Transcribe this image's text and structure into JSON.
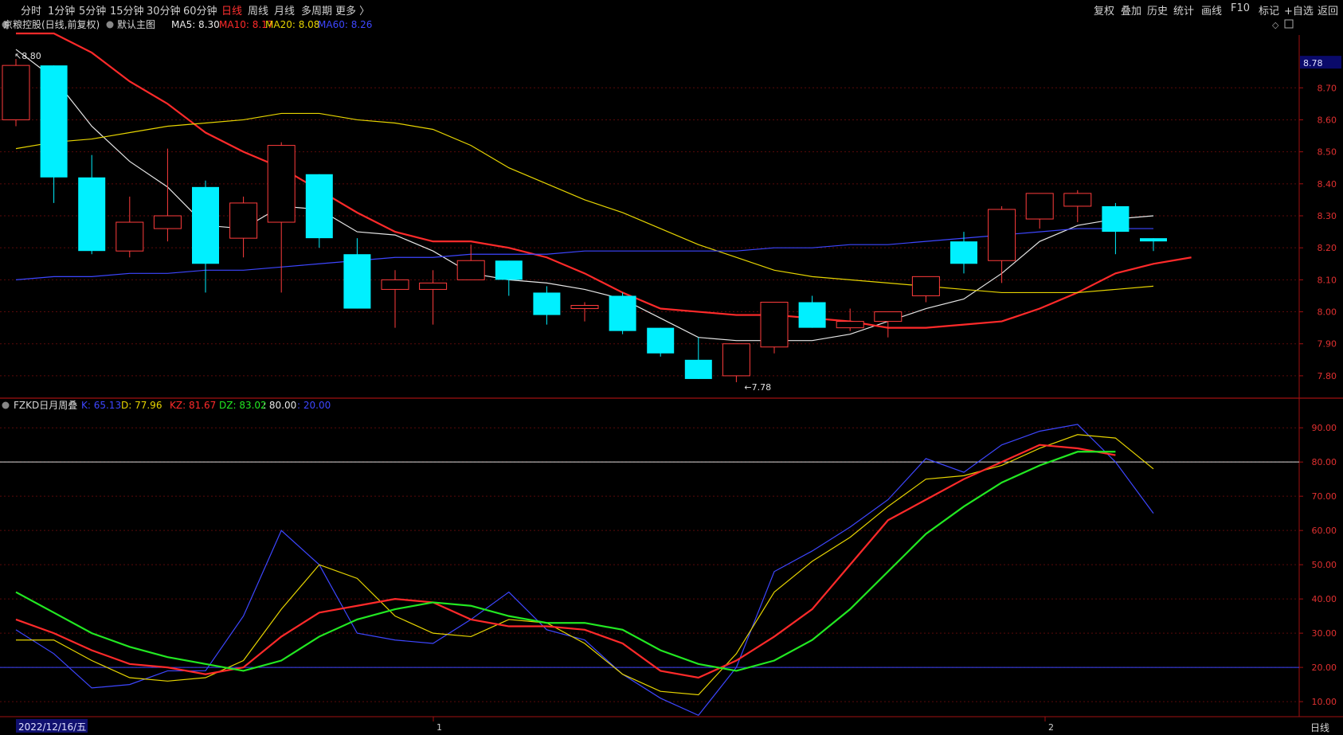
{
  "toolbar": {
    "left": [
      {
        "label": "分时",
        "active": false
      },
      {
        "label": "1分钟",
        "active": false
      },
      {
        "label": "5分钟",
        "active": false
      },
      {
        "label": "15分钟",
        "active": false
      },
      {
        "label": "30分钟",
        "active": false
      },
      {
        "label": "60分钟",
        "active": false
      },
      {
        "label": "日线",
        "active": true
      },
      {
        "label": "周线",
        "active": false
      },
      {
        "label": "月线",
        "active": false
      },
      {
        "label": "多周期",
        "active": false
      },
      {
        "label": "更多 〉",
        "active": false
      }
    ],
    "right": [
      "复权",
      "叠加",
      "历史",
      "统计",
      "画线",
      "F10",
      "标记",
      "+自选",
      "返回"
    ]
  },
  "main_header": {
    "stock": "京粮控股(日线,前复权)",
    "template": "默认主图",
    "ma": [
      {
        "label": "MA5: 8.30",
        "color": "#e6e6e6"
      },
      {
        "label": "MA10: 8.17",
        "color": "#ff2a2a"
      },
      {
        "label": "MA20: 8.08",
        "color": "#e6d400"
      },
      {
        "label": "MA60: 8.26",
        "color": "#3d46ff"
      }
    ]
  },
  "sub_header": {
    "name": "FZKD日月周叠",
    "items": [
      {
        "label": "K: 65.13",
        "color": "#3d46ff"
      },
      {
        "label": "D: 77.96",
        "color": "#e6d400"
      },
      {
        "label": "KZ: 81.67",
        "color": "#ff2a2a"
      },
      {
        "label": "DZ: 83.02",
        "color": "#22e822"
      },
      {
        "label": ": 80.00",
        "color": "#e6e6e6"
      },
      {
        "label": ": 20.00",
        "color": "#3d46ff"
      }
    ]
  },
  "bottom_axis": {
    "date_label": "2022/12/16/五",
    "month_labels": [
      "1",
      "2"
    ],
    "period_label": "日线"
  },
  "colors": {
    "up": "#ff3c3c",
    "down": "#00f0ff",
    "ma5": "#e6e6e6",
    "ma10": "#ff2a2a",
    "ma20": "#e6d400",
    "ma60": "#3d46ff",
    "dz": "#22e822",
    "grid": "#5a0a0a",
    "border": "#a01010"
  },
  "chart_data": [
    {
      "type": "candlestick",
      "title": "京粮控股(日线,前复权)",
      "ylim": [
        7.75,
        8.85
      ],
      "y_ticks": [
        7.8,
        7.9,
        8.0,
        8.1,
        8.2,
        8.3,
        8.4,
        8.5,
        8.6,
        8.7
      ],
      "current_price": "8.78",
      "high_label": "8.80",
      "low_label": "7.78",
      "candles": [
        {
          "o": 8.6,
          "h": 8.79,
          "l": 8.58,
          "c": 8.77
        },
        {
          "o": 8.77,
          "h": 8.77,
          "l": 8.34,
          "c": 8.42
        },
        {
          "o": 8.42,
          "h": 8.49,
          "l": 8.18,
          "c": 8.19
        },
        {
          "o": 8.19,
          "h": 8.36,
          "l": 8.17,
          "c": 8.28
        },
        {
          "o": 8.26,
          "h": 8.51,
          "l": 8.22,
          "c": 8.3
        },
        {
          "o": 8.39,
          "h": 8.41,
          "l": 8.06,
          "c": 8.15
        },
        {
          "o": 8.23,
          "h": 8.36,
          "l": 8.17,
          "c": 8.34
        },
        {
          "o": 8.28,
          "h": 8.53,
          "l": 8.06,
          "c": 8.52
        },
        {
          "o": 8.43,
          "h": 8.43,
          "l": 8.2,
          "c": 8.23
        },
        {
          "o": 8.18,
          "h": 8.23,
          "l": 8.01,
          "c": 8.01
        },
        {
          "o": 8.07,
          "h": 8.13,
          "l": 7.95,
          "c": 8.1
        },
        {
          "o": 8.07,
          "h": 8.13,
          "l": 7.96,
          "c": 8.09
        },
        {
          "o": 8.1,
          "h": 8.21,
          "l": 8.1,
          "c": 8.16
        },
        {
          "o": 8.16,
          "h": 8.16,
          "l": 8.05,
          "c": 8.1
        },
        {
          "o": 8.06,
          "h": 8.08,
          "l": 7.96,
          "c": 7.99
        },
        {
          "o": 8.01,
          "h": 8.03,
          "l": 7.97,
          "c": 8.02
        },
        {
          "o": 8.05,
          "h": 8.06,
          "l": 7.93,
          "c": 7.94
        },
        {
          "o": 7.95,
          "h": 7.95,
          "l": 7.86,
          "c": 7.87
        },
        {
          "o": 7.85,
          "h": 7.92,
          "l": 7.79,
          "c": 7.79
        },
        {
          "o": 7.8,
          "h": 7.9,
          "l": 7.78,
          "c": 7.9
        },
        {
          "o": 7.89,
          "h": 8.03,
          "l": 7.87,
          "c": 8.03
        },
        {
          "o": 8.03,
          "h": 8.05,
          "l": 7.95,
          "c": 7.95
        },
        {
          "o": 7.95,
          "h": 8.01,
          "l": 7.94,
          "c": 7.97
        },
        {
          "o": 7.97,
          "h": 8.0,
          "l": 7.92,
          "c": 8.0
        },
        {
          "o": 8.05,
          "h": 8.11,
          "l": 8.03,
          "c": 8.11
        },
        {
          "o": 8.22,
          "h": 8.25,
          "l": 8.12,
          "c": 8.15
        },
        {
          "o": 8.16,
          "h": 8.33,
          "l": 8.09,
          "c": 8.32
        },
        {
          "o": 8.29,
          "h": 8.37,
          "l": 8.26,
          "c": 8.37
        },
        {
          "o": 8.33,
          "h": 8.38,
          "l": 8.28,
          "c": 8.37
        },
        {
          "o": 8.33,
          "h": 8.34,
          "l": 8.18,
          "c": 8.25
        },
        {
          "o": 8.23,
          "h": 8.23,
          "l": 8.19,
          "c": 8.22
        }
      ],
      "series": [
        {
          "name": "MA5",
          "values": [
            8.82,
            8.73,
            8.58,
            8.47,
            8.39,
            8.27,
            8.26,
            8.33,
            8.32,
            8.25,
            8.24,
            8.19,
            8.12,
            8.1,
            8.09,
            8.07,
            8.04,
            7.98,
            7.92,
            7.91,
            7.91,
            7.91,
            7.93,
            7.97,
            8.01,
            8.04,
            8.12,
            8.22,
            8.27,
            8.29,
            8.3
          ]
        },
        {
          "name": "MA10",
          "values": [
            8.87,
            8.87,
            8.81,
            8.72,
            8.65,
            8.56,
            8.5,
            8.45,
            8.38,
            8.31,
            8.25,
            8.22,
            8.22,
            8.2,
            8.17,
            8.12,
            8.06,
            8.01,
            8.0,
            7.99,
            7.99,
            7.98,
            7.97,
            7.95,
            7.95,
            7.96,
            7.97,
            8.01,
            8.06,
            8.12,
            8.15,
            8.17
          ]
        },
        {
          "name": "MA20",
          "values": [
            8.51,
            8.53,
            8.54,
            8.56,
            8.58,
            8.59,
            8.6,
            8.62,
            8.62,
            8.6,
            8.59,
            8.57,
            8.52,
            8.45,
            8.4,
            8.35,
            8.31,
            8.26,
            8.21,
            8.17,
            8.13,
            8.11,
            8.1,
            8.09,
            8.08,
            8.07,
            8.06,
            8.06,
            8.06,
            8.07,
            8.08
          ]
        },
        {
          "name": "MA60",
          "values": [
            8.1,
            8.11,
            8.11,
            8.12,
            8.12,
            8.13,
            8.13,
            8.14,
            8.15,
            8.16,
            8.17,
            8.17,
            8.18,
            8.18,
            8.18,
            8.19,
            8.19,
            8.19,
            8.19,
            8.19,
            8.2,
            8.2,
            8.21,
            8.21,
            8.22,
            8.23,
            8.24,
            8.25,
            8.26,
            8.26,
            8.26
          ]
        }
      ]
    },
    {
      "type": "line",
      "title": "FZKD日月周叠",
      "ylim": [
        7,
        94
      ],
      "y_ticks": [
        10,
        20,
        30,
        40,
        50,
        60,
        70,
        80,
        90
      ],
      "ref_lines": [
        80,
        20
      ],
      "series": [
        {
          "name": "K",
          "values": [
            31,
            24,
            14,
            15,
            19,
            19,
            35,
            60,
            50,
            30,
            28,
            27,
            34,
            42,
            31,
            28,
            18,
            11,
            6,
            20,
            48,
            54,
            61,
            69,
            81,
            77,
            85,
            89,
            91,
            80,
            65
          ]
        },
        {
          "name": "D",
          "values": [
            28,
            28,
            22,
            17,
            16,
            17,
            22,
            37,
            50,
            46,
            35,
            30,
            29,
            34,
            33,
            27,
            18,
            13,
            12,
            24,
            42,
            51,
            58,
            67,
            75,
            76,
            79,
            84,
            88,
            87,
            78
          ]
        },
        {
          "name": "KZ",
          "values": [
            34,
            30,
            25,
            21,
            20,
            18,
            20,
            29,
            36,
            38,
            40,
            39,
            34,
            32,
            32,
            31,
            27,
            19,
            17,
            22,
            29,
            37,
            50,
            63,
            69,
            75,
            80,
            85,
            84,
            82
          ]
        },
        {
          "name": "DZ",
          "values": [
            42,
            36,
            30,
            26,
            23,
            21,
            19,
            22,
            29,
            34,
            37,
            39,
            38,
            35,
            33,
            33,
            31,
            25,
            21,
            19,
            22,
            28,
            37,
            48,
            59,
            67,
            74,
            79,
            83,
            83
          ]
        }
      ]
    }
  ]
}
